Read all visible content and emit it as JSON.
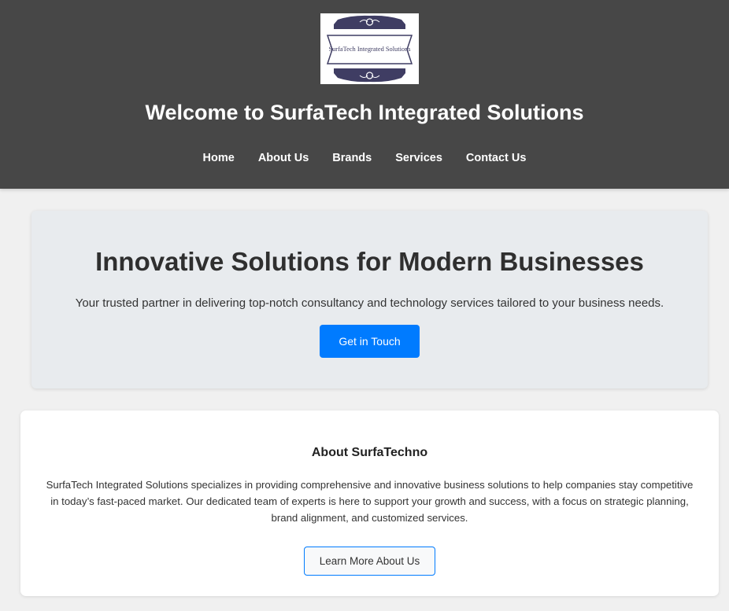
{
  "header": {
    "logo_text": "SurfaTech Integrated Solutions",
    "title": "Welcome to SurfaTech Integrated Solutions",
    "nav": [
      "Home",
      "About Us",
      "Brands",
      "Services",
      "Contact Us"
    ]
  },
  "hero": {
    "heading": "Innovative Solutions for Modern Businesses",
    "tagline": "Your trusted partner in delivering top-notch consultancy and technology services tailored to your business needs.",
    "cta_label": "Get in Touch",
    "cta_color": "#007bff"
  },
  "about": {
    "heading": "About SurfaTechno",
    "body": "SurfaTech Integrated Solutions specializes in providing comprehensive and innovative business solutions to help companies stay competitive in today’s fast-paced market. Our dedicated team of experts is here to support your growth and success, with a focus on strategic planning, brand alignment, and customized services.",
    "button_label": "Learn More About Us"
  },
  "colors": {
    "header_bg": "#474747",
    "logo_ribbon": "#3f3d63",
    "accent": "#007bff"
  }
}
